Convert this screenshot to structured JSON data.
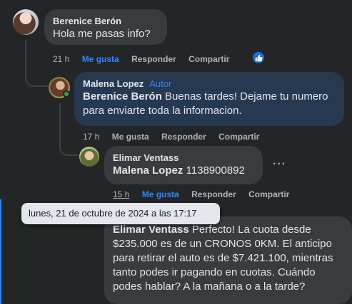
{
  "comments": [
    {
      "author": "Berenice Berón",
      "text": "Hola me pasas info?",
      "time": "21 h",
      "like": "Me gusta",
      "reply": "Responder",
      "share": "Compartir"
    },
    {
      "author": "Malena Lopez",
      "badge": "Autor",
      "mention": "Berenice Berón",
      "text": " Buenas tardes! Dejame tu numero para enviarte toda la informacion.",
      "time": "17 h",
      "like": "Me gusta",
      "reply": "Responder",
      "share": "Compartir"
    },
    {
      "author": "Elimar Ventass",
      "mention": "Malena Lopez",
      "text": " 1138900892",
      "time": "15 h",
      "like": "Me gusta",
      "reply": "Responder",
      "share": "Compartir"
    },
    {
      "mention": "Elimar Ventass",
      "text": " Perfecto! La cuota desde $235.000 es de un CRONOS 0KM. El anticipo para retirar el auto es de $7.421.100, mientras tanto podes ir pagando en cuotas. Cuándo podes hablar? A la mañana o a la tarde?"
    }
  ],
  "tooltip": "lunes, 21 de octubre de 2024 a las 17:17",
  "more_icon": "···",
  "colors": {
    "background": "#242526",
    "bubble": "#3a3b3c",
    "highlight_bubble": "#263951",
    "accent": "#2d88ff"
  }
}
